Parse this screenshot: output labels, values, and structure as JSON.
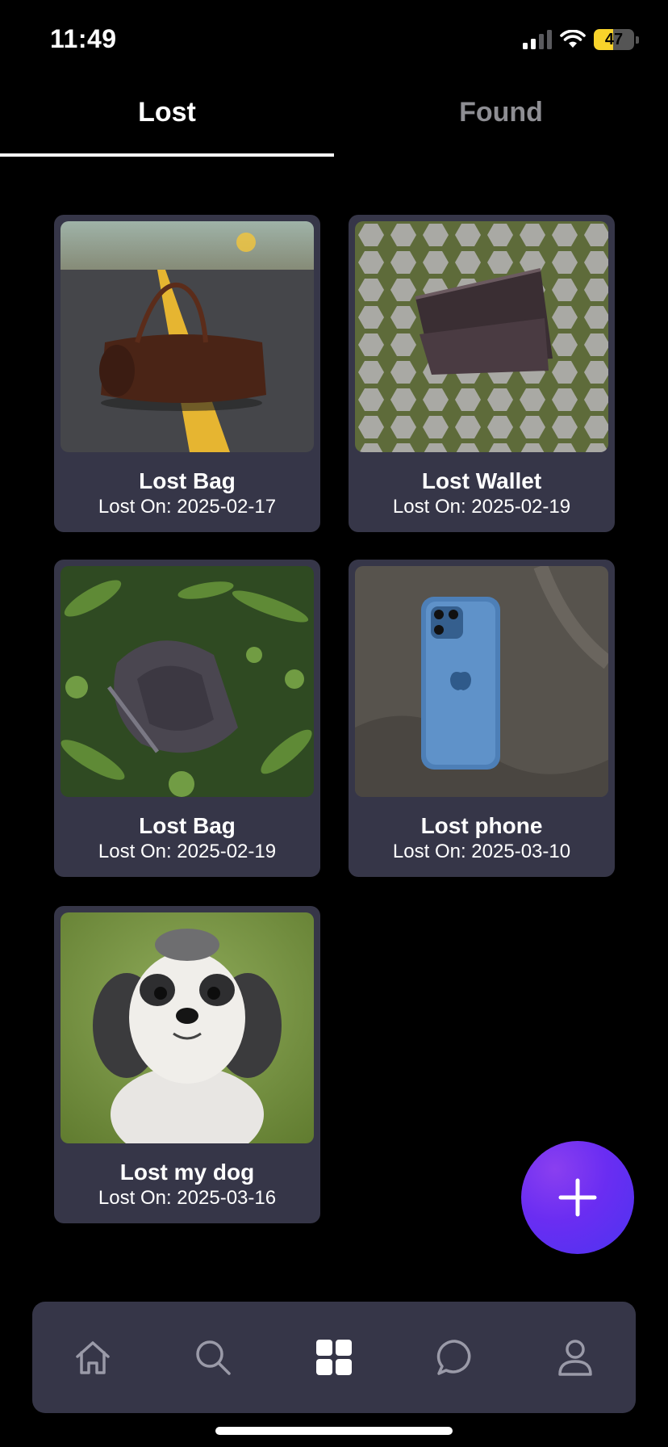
{
  "status_bar": {
    "time": "11:49",
    "battery": "47",
    "battery_level": 0.47
  },
  "tabs": [
    {
      "label": "Lost",
      "active": true
    },
    {
      "label": "Found",
      "active": false
    }
  ],
  "cards": [
    {
      "title": "Lost Bag",
      "date": "Lost On: 2025-02-17",
      "image": "duffel-bag-on-road"
    },
    {
      "title": "Lost Wallet",
      "date": "Lost On: 2025-02-19",
      "image": "wallet-on-pavers"
    },
    {
      "title": "Lost Bag",
      "date": "Lost On: 2025-02-19",
      "image": "backpack-in-grass"
    },
    {
      "title": "Lost phone",
      "date": "Lost On: 2025-03-10",
      "image": "blue-iphone-on-fabric"
    },
    {
      "title": "Lost my dog",
      "date": "Lost On: 2025-03-16",
      "image": "shih-tzu-dog"
    }
  ],
  "fab": {
    "icon": "plus-icon"
  },
  "bottom_nav": [
    {
      "icon": "home-icon",
      "active": false
    },
    {
      "icon": "search-icon",
      "active": false
    },
    {
      "icon": "grid-icon",
      "active": true
    },
    {
      "icon": "chat-icon",
      "active": false
    },
    {
      "icon": "profile-icon",
      "active": false
    }
  ],
  "colors": {
    "card_bg": "#363648",
    "accent": "#6a2df2",
    "nav_inactive": "#9a9aa8"
  }
}
